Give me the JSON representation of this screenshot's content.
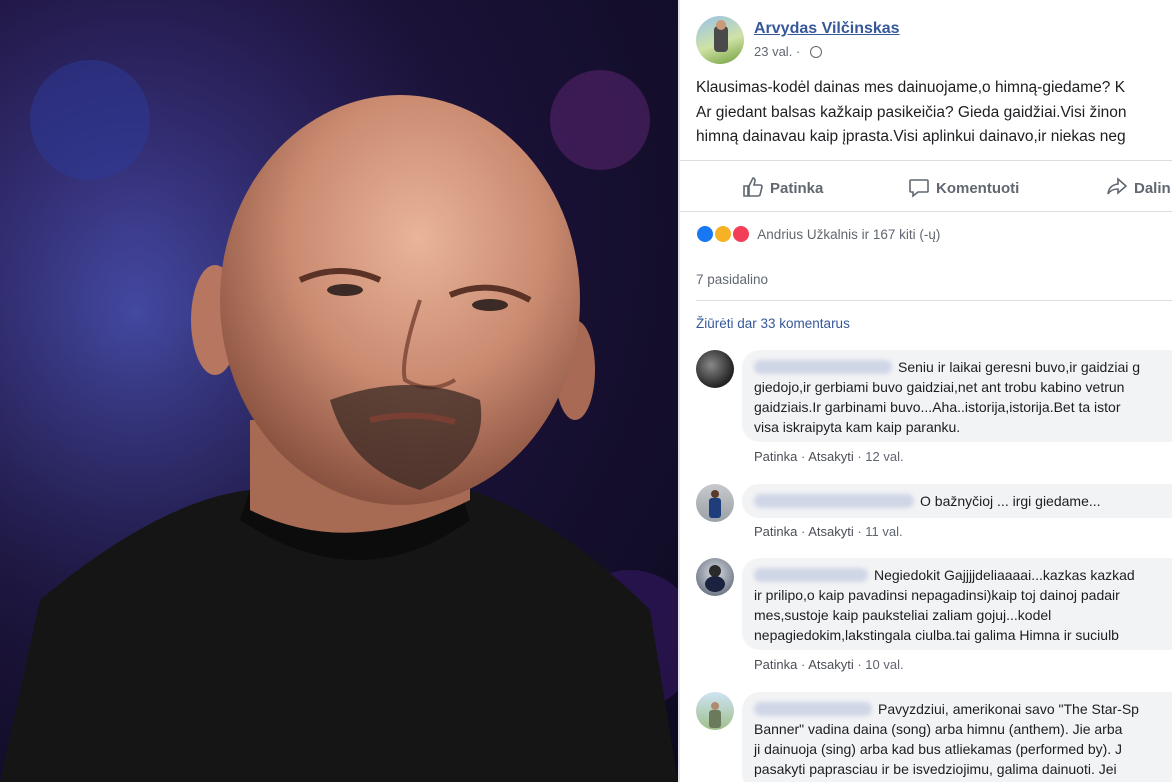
{
  "post": {
    "author": "Arvydas Vilčinskas",
    "time": "23 val.",
    "body_lines": [
      "Klausimas-kodėl dainas mes dainuojame,o himną-giedame? K",
      "Ar giedant balsas kažkaip pasikeičia? Gieda gaidžiai.Visi žinon",
      "himną dainavau kaip įprasta.Visi aplinkui dainavo,ir niekas neg"
    ],
    "actions": {
      "like": "Patinka",
      "comment": "Komentuoti",
      "share": "Dalin"
    },
    "reactions_text": "Andrius Užkalnis ir 167 kiti (-ų)",
    "shares_text": "7 pasidalino",
    "more_comments": "Žiūrėti dar 33 komentarus"
  },
  "comments": [
    {
      "lines": [
        "Seniu ir laikai geresni buvo,ir gaidziai g",
        "giedojo,ir gerbiami buvo gaidziai,net ant trobu kabino vetrun",
        "gaidziais.Ir garbinami buvo...Aha..istorija,istorija.Bet ta istor",
        "visa iskraipyta kam kaip paranku."
      ],
      "like": "Patinka",
      "reply": "Atsakyti",
      "time": "12 val."
    },
    {
      "lines": [
        "O bažnyčioj ... irgi giedame..."
      ],
      "like": "Patinka",
      "reply": "Atsakyti",
      "time": "11 val."
    },
    {
      "lines": [
        "Negiedokit Gajjjjdeliaaaai...kazkas kazkad",
        "ir prilipo,o kaip pavadinsi nepagadinsi)kaip toj dainoj padair",
        "mes,sustoje kaip pauksteliai zaliam gojuj...kodel",
        "nepagiedokim,lakstingala ciulba.tai galima Himna ir suciulb"
      ],
      "like": "Patinka",
      "reply": "Atsakyti",
      "time": "10 val."
    },
    {
      "lines": [
        "Pavyzdziui, amerikonai savo \"The Star-Sp",
        "Banner\" vadina daina (song) arba himnu (anthem). Jie arba",
        "ji dainuoja (sing) arba kad bus atliekamas (performed by). J",
        "pasakyti paprasciau ir be isvedziojimu, galima dainuoti. Jei"
      ]
    }
  ],
  "colors": {
    "link": "#365899",
    "like": "#1877f2",
    "haha": "#f7b125",
    "love": "#f33e58"
  },
  "icons": [
    "thumbs-up-icon",
    "comment-icon",
    "share-icon",
    "globe-icon"
  ]
}
